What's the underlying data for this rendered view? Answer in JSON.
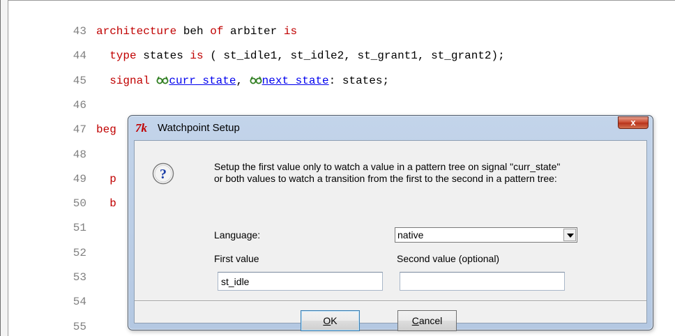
{
  "editor": {
    "lines": [
      {
        "num": "43",
        "segments": [
          [
            "kw",
            "architecture"
          ],
          [
            "t",
            " beh "
          ],
          [
            "kw",
            "of"
          ],
          [
            "t",
            " arbiter "
          ],
          [
            "kw",
            "is"
          ]
        ]
      },
      {
        "num": "44",
        "segments": [
          [
            "t",
            "  "
          ],
          [
            "kw",
            "type"
          ],
          [
            "t",
            " states "
          ],
          [
            "kw",
            "is"
          ],
          [
            "t",
            " ( st_idle1, st_idle2, st_grant1, st_grant2);"
          ]
        ]
      },
      {
        "num": "45",
        "segments": [
          [
            "t",
            "  "
          ],
          [
            "kw",
            "signal"
          ],
          [
            "t",
            " "
          ],
          [
            "icon",
            "watch-glasses"
          ],
          [
            "link",
            "curr_state"
          ],
          [
            "t",
            ", "
          ],
          [
            "icon",
            "watch-glasses"
          ],
          [
            "link",
            "next_state"
          ],
          [
            "t",
            ": states;"
          ]
        ]
      },
      {
        "num": "46",
        "segments": []
      },
      {
        "num": "47",
        "segments": [
          [
            "kw",
            "beg"
          ]
        ]
      },
      {
        "num": "48",
        "segments": []
      },
      {
        "num": "49",
        "segments": [
          [
            "t",
            "  "
          ],
          [
            "kw",
            "p"
          ]
        ]
      },
      {
        "num": "50",
        "segments": [
          [
            "t",
            "  "
          ],
          [
            "kw",
            "b"
          ]
        ]
      },
      {
        "num": "51",
        "segments": []
      },
      {
        "num": "52",
        "segments": []
      },
      {
        "num": "53",
        "segments": []
      },
      {
        "num": "54",
        "segments": []
      },
      {
        "num": "55",
        "segments": []
      }
    ]
  },
  "dialog": {
    "app_icon": "7k",
    "title": "Watchpoint Setup",
    "close_label": "x",
    "message_line1": "Setup the first value only to watch a value in a pattern tree on signal \"curr_state\"",
    "message_line2": "or both values to watch a transition from the first to the second in a pattern tree:",
    "language_label": "Language:",
    "language_value": "native",
    "first_value_label": "First value",
    "first_value": "st_idle",
    "second_value_label": "Second value (optional)",
    "second_value": "",
    "ok_mnemonic": "O",
    "ok_rest": "K",
    "cancel_mnemonic": "C",
    "cancel_rest": "ancel"
  },
  "colors": {
    "keyword": "#c00000",
    "link": "#0000ee",
    "line_number": "#808080",
    "title_bar": "#b4c8e2",
    "close_button": "#c9462c"
  }
}
